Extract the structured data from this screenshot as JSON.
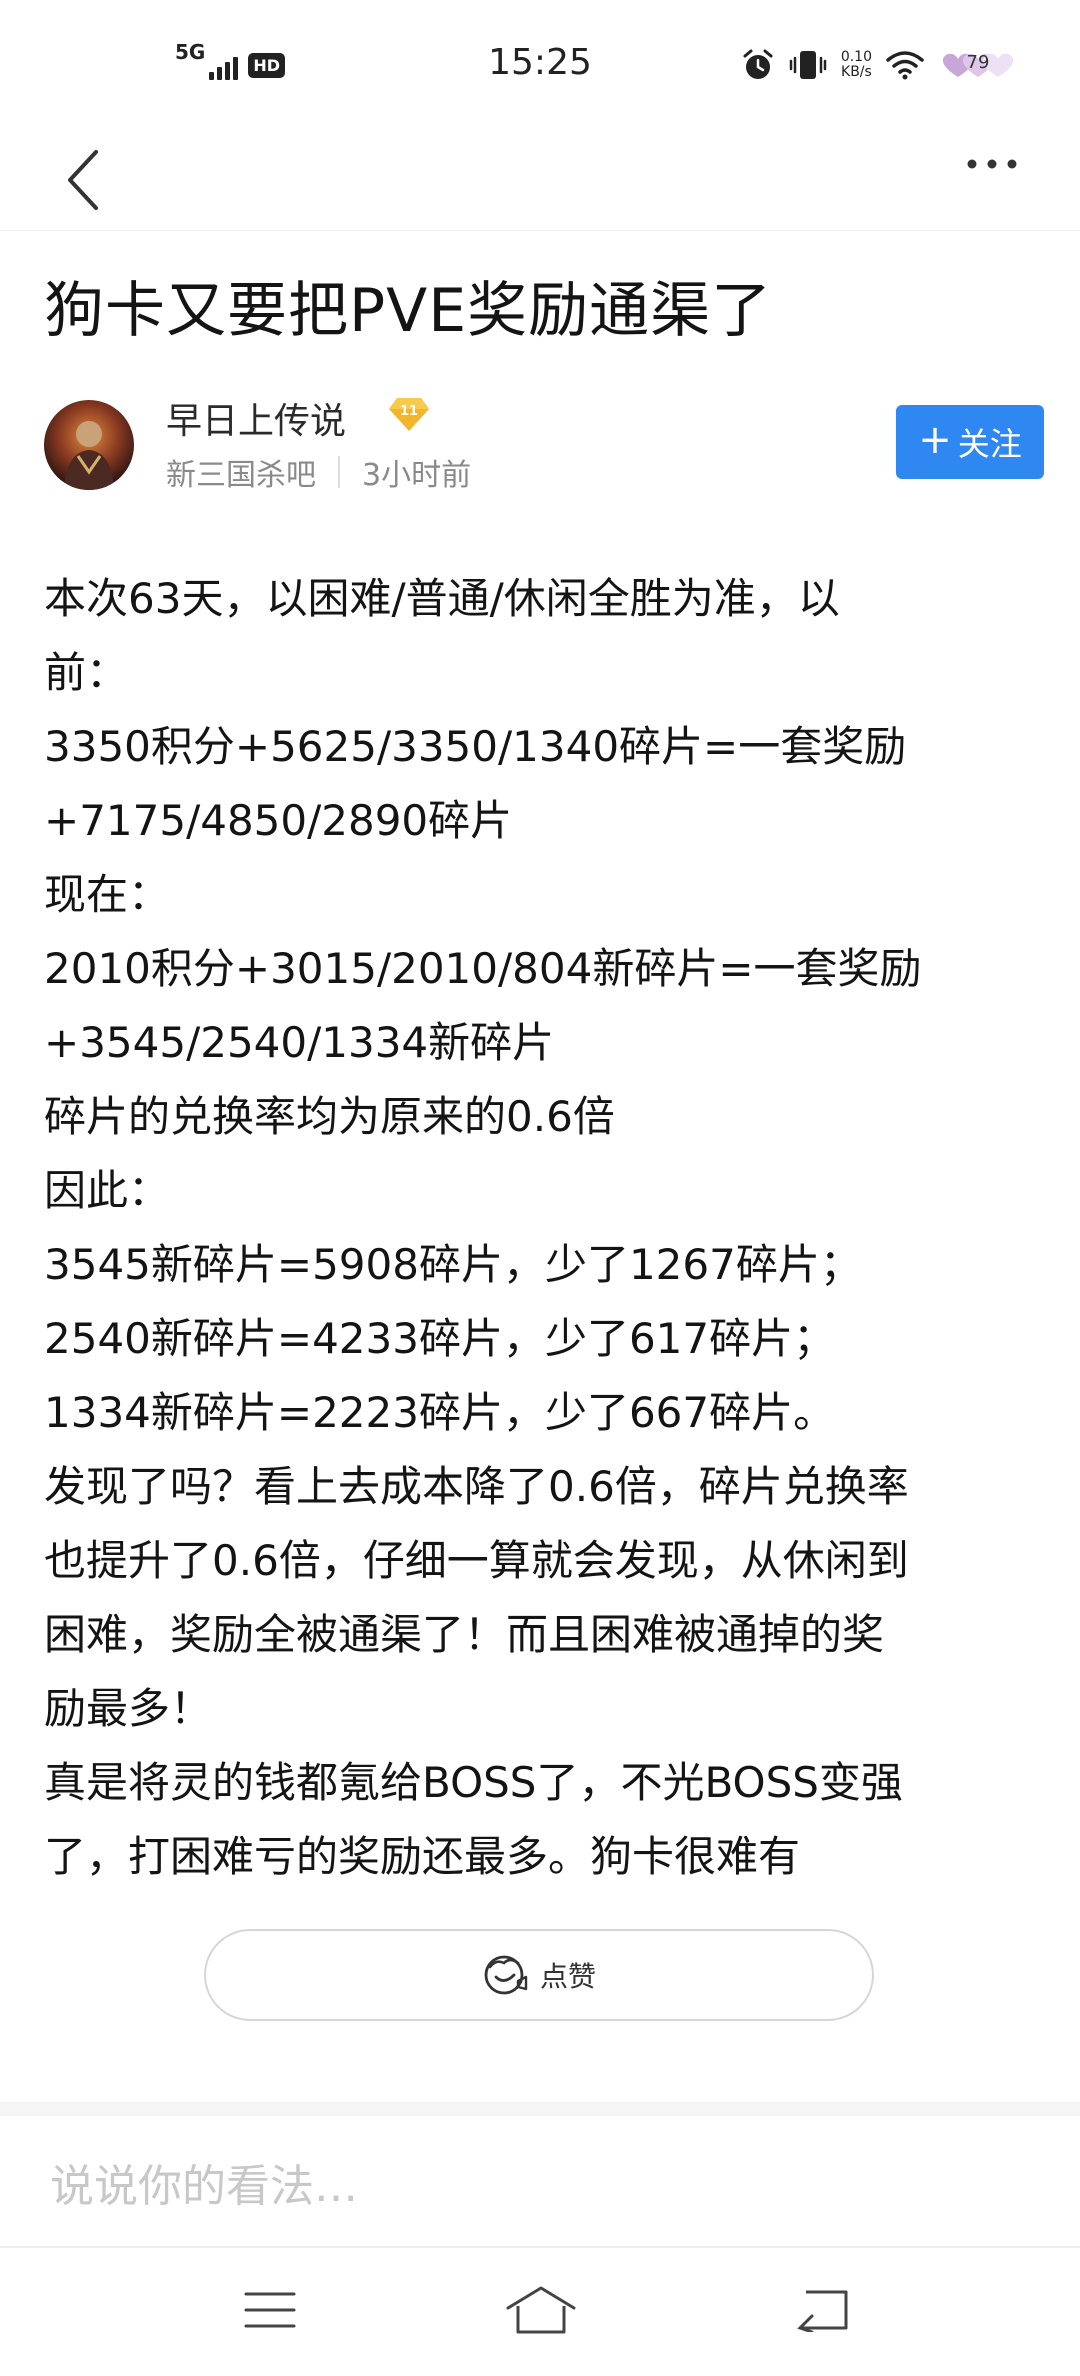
{
  "status_bar": {
    "signal_label": "5G",
    "hd_label": "HD",
    "time": "15:25",
    "net_speed_value": "0.10",
    "net_speed_unit": "KB/s",
    "battery": "79"
  },
  "post": {
    "title": "狗卡又要把PVE奖励通渠了",
    "author": {
      "name": "早日上传说",
      "level": "11",
      "forum": "新三国杀吧",
      "time_ago": "3小时前"
    },
    "follow_label": "关注",
    "body_lines": [
      "本次63天，以困难/普通/休闲全胜为准，以",
      "前：",
      "3350积分+5625/3350/1340碎片=一套奖励",
      "+7175/4850/2890碎片",
      "现在：",
      "2010积分+3015/2010/804新碎片=一套奖励",
      "+3545/2540/1334新碎片",
      "碎片的兑换率均为原来的0.6倍",
      "因此：",
      "3545新碎片=5908碎片，少了1267碎片；",
      "2540新碎片=4233碎片，少了617碎片；",
      "1334新碎片=2223碎片，少了667碎片。",
      "发现了吗？看上去成本降了0.6倍，碎片兑换率",
      "也提升了0.6倍，仔细一算就会发现，从休闲到",
      "困难，奖励全被通渠了！而且困难被通掉的奖",
      "励最多！",
      "真是将灵的钱都氪给BOSS了，不光BOSS变强",
      "了，打困难亏的奖励还最多。狗卡很难有"
    ],
    "like_label": "点赞"
  },
  "comment_placeholder": "说说你的看法…",
  "colors": {
    "accent": "#2f87f2",
    "level_badge": "#f3b62b"
  },
  "icons": {
    "back": "chevron-left-icon",
    "more": "more-dots-icon",
    "like": "thumbs-up-icon",
    "alarm": "alarm-icon",
    "vibrate": "vibrate-icon",
    "wifi": "wifi-icon"
  }
}
